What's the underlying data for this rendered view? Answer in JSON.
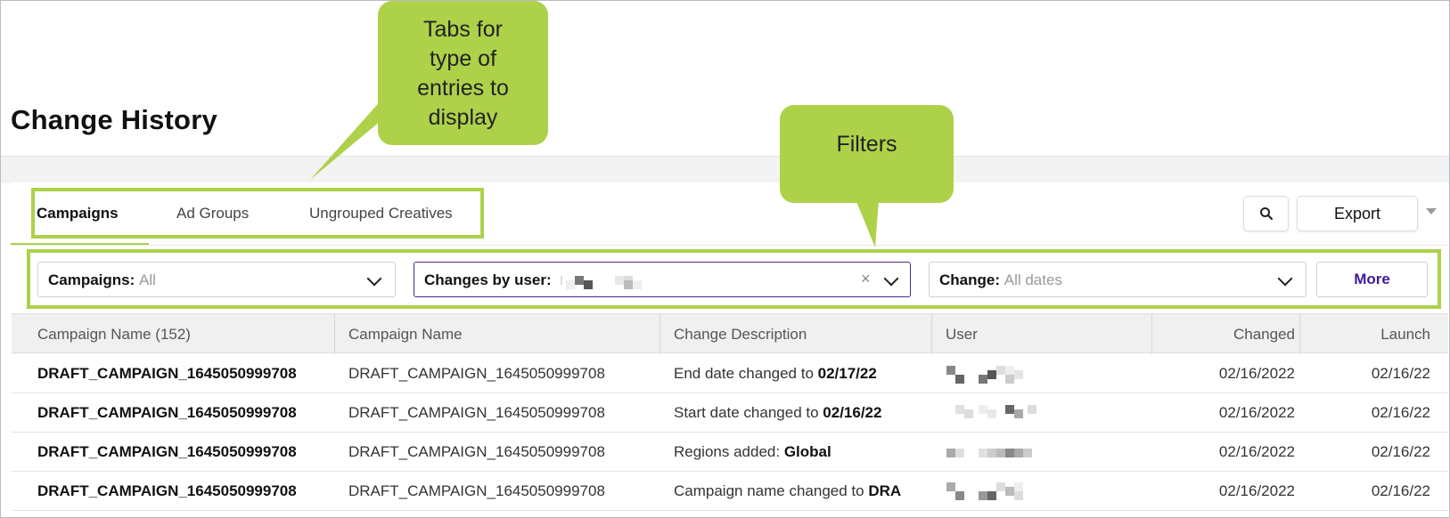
{
  "page": {
    "title": "Change History"
  },
  "callouts": {
    "tabs_note": "Tabs for type of entries to display",
    "filters_note": "Filters"
  },
  "tabs": [
    {
      "label": "Campaigns",
      "active": true
    },
    {
      "label": "Ad Groups",
      "active": false
    },
    {
      "label": "Ungrouped Creatives",
      "active": false
    }
  ],
  "toolbar": {
    "search_icon": "search-icon",
    "export_label": "Export"
  },
  "filters": {
    "campaigns": {
      "label": "Campaigns:",
      "value": "All"
    },
    "user": {
      "label": "Changes by user:"
    },
    "change": {
      "label": "Change:",
      "value": "All dates"
    },
    "more_label": "More"
  },
  "table": {
    "headers": [
      "Campaign Name (152)",
      "Campaign Name",
      "Change Description",
      "User",
      "Changed",
      "Launch"
    ],
    "rows": [
      {
        "campaign_bold": "DRAFT_CAMPAIGN_1645050999708",
        "campaign": "DRAFT_CAMPAIGN_1645050999708",
        "desc_prefix": "End date changed to ",
        "desc_value": "02/17/22",
        "changed": "02/16/2022",
        "launch": "02/16/22"
      },
      {
        "campaign_bold": "DRAFT_CAMPAIGN_1645050999708",
        "campaign": "DRAFT_CAMPAIGN_1645050999708",
        "desc_prefix": "Start date changed to ",
        "desc_value": "02/16/22",
        "changed": "02/16/2022",
        "launch": "02/16/22"
      },
      {
        "campaign_bold": "DRAFT_CAMPAIGN_1645050999708",
        "campaign": "DRAFT_CAMPAIGN_1645050999708",
        "desc_prefix": "Regions added: ",
        "desc_value": "Global",
        "changed": "02/16/2022",
        "launch": "02/16/22"
      },
      {
        "campaign_bold": "DRAFT_CAMPAIGN_1645050999708",
        "campaign": "DRAFT_CAMPAIGN_1645050999708",
        "desc_prefix": "Campaign name changed to ",
        "desc_value": "DRA",
        "changed": "02/16/2022",
        "launch": "02/16/22"
      }
    ]
  },
  "colors": {
    "highlight": "#aed14a",
    "accent": "#3d1b9c",
    "focus_border": "#4b2a8a"
  }
}
